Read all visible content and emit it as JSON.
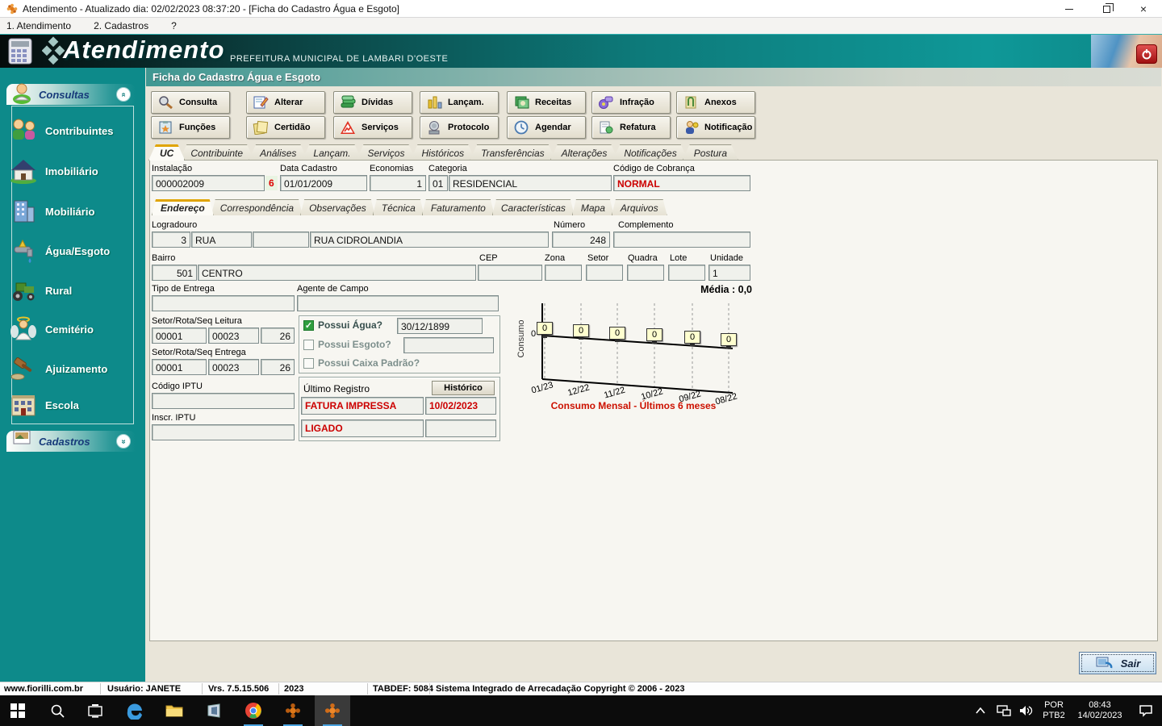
{
  "window": {
    "title": "Atendimento - Atualizado dia: 02/02/2023 08:37:20 - [Ficha do Cadastro Água e Esgoto]"
  },
  "menubar": {
    "items": [
      "1. Atendimento",
      "2. Cadastros",
      "?"
    ]
  },
  "banner": {
    "app_name": "Atendimento",
    "org": "PREFEITURA MUNICIPAL DE LAMBARI D'OESTE"
  },
  "sidebar": {
    "consultas_label": "Consultas",
    "items": [
      {
        "label": "Contribuintes"
      },
      {
        "label": "Imobiliário"
      },
      {
        "label": "Mobiliário"
      },
      {
        "label": "Água/Esgoto"
      },
      {
        "label": "Rural"
      },
      {
        "label": "Cemitério"
      },
      {
        "label": "Ajuizamento"
      },
      {
        "label": "Escola"
      }
    ],
    "cadastros_label": "Cadastros"
  },
  "panel_title": "Ficha do Cadastro Água e Esgoto",
  "toolbar": {
    "row1": [
      {
        "label": "Consulta"
      },
      {
        "label": "Alterar"
      },
      {
        "label": "Dívidas"
      },
      {
        "label": "Lançam."
      },
      {
        "label": "Receitas"
      },
      {
        "label": "Infração"
      },
      {
        "label": "Anexos"
      }
    ],
    "row2": [
      {
        "label": "Funções"
      },
      {
        "label": "Certidão"
      },
      {
        "label": "Serviços"
      },
      {
        "label": "Protocolo"
      },
      {
        "label": "Agendar"
      },
      {
        "label": "Refatura"
      },
      {
        "label": "Notificação"
      }
    ]
  },
  "tabs": [
    "UC",
    "Contribuinte",
    "Análises",
    "Lançam.",
    "Serviços",
    "Históricos",
    "Transferências",
    "Alterações",
    "Notificações",
    "Postura"
  ],
  "uc": {
    "instalacao_label": "Instalação",
    "instalacao": "000002009",
    "flag": "6",
    "data_cadastro_label": "Data Cadastro",
    "data_cadastro": "01/01/2009",
    "economias_label": "Economias",
    "economias": "1",
    "categoria_label": "Categoria",
    "categoria_cod": "01",
    "categoria_desc": "RESIDENCIAL",
    "cobranca_label": "Código de Cobrança",
    "cobranca": "NORMAL"
  },
  "subtabs": [
    "Endereço",
    "Correspondência",
    "Observações",
    "Técnica",
    "Faturamento",
    "Características",
    "Mapa",
    "Arquivos"
  ],
  "endereco": {
    "logradouro_label": "Logradouro",
    "numero_label": "Número",
    "complemento_label": "Complemento",
    "logr_tipo_cod": "3",
    "logr_tipo": "RUA",
    "logr_extra": "",
    "logradouro": "RUA CIDROLANDIA",
    "numero": "248",
    "complemento": "",
    "bairro_label": "Bairro",
    "bairro_cod": "501",
    "bairro": "CENTRO",
    "cep_label": "CEP",
    "cep": "",
    "zona_label": "Zona",
    "zona": "",
    "setor_label": "Setor",
    "setor": "",
    "quadra_label": "Quadra",
    "quadra": "",
    "lote_label": "Lote",
    "lote": "",
    "unidade_label": "Unidade",
    "unidade": "1",
    "tipo_entrega_label": "Tipo de Entrega",
    "tipo_entrega": "",
    "agente_label": "Agente de Campo",
    "agente": "",
    "leitura_label": "Setor/Rota/Seq Leitura",
    "leitura": [
      "00001",
      "00023",
      "26"
    ],
    "entrega_label": "Setor/Rota/Seq Entrega",
    "entrega": [
      "00001",
      "00023",
      "26"
    ],
    "codigo_iptu_label": "Código IPTU",
    "codigo_iptu": "",
    "inscr_iptu_label": "Inscr. IPTU",
    "inscr_iptu": ""
  },
  "flags": {
    "agua_label": "Possui Água?",
    "agua_checked": true,
    "agua_data": "30/12/1899",
    "esgoto_label": "Possui Esgoto?",
    "esgoto_valor": "",
    "caixa_label": "Possui Caixa Padrão?"
  },
  "registro": {
    "label": "Último Registro",
    "historico": "Histórico",
    "status": "FATURA IMPRESSA",
    "data": "10/02/2023",
    "ligacao": "LIGADO",
    "ligacao_data": ""
  },
  "chart_data": {
    "type": "line",
    "title": "Consumo Mensal - Últimos 6 meses",
    "media_label": "Média : 0,0",
    "ylabel": "Consumo",
    "ytick": "0",
    "categories": [
      "01/23",
      "12/22",
      "11/22",
      "10/22",
      "09/22",
      "08/22"
    ],
    "values": [
      0,
      0,
      0,
      0,
      0,
      0
    ],
    "ylim": [
      0,
      1
    ],
    "grid": true,
    "legend_position": "none"
  },
  "footer": {
    "sair": "Sair"
  },
  "statusbar": [
    "www.fiorilli.com.br",
    "Usuário: JANETE",
    "Vrs. 7.5.15.506",
    "2023",
    "TABDEF: 5084",
    "Sistema Integrado de Arrecadação Copyright © 2006 - 2023"
  ],
  "taskbar": {
    "lang_top": "POR",
    "lang_bottom": "PTB2",
    "time": "08:43",
    "date": "14/02/2023"
  }
}
